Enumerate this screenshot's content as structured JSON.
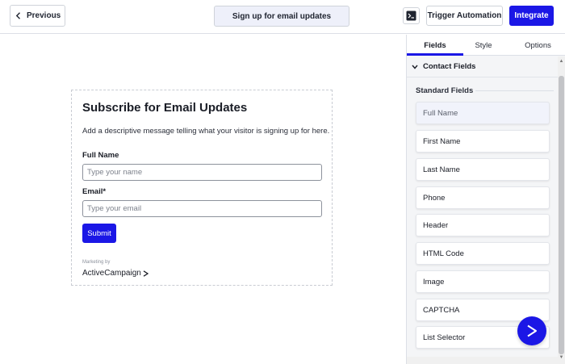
{
  "toolbar": {
    "previous_label": "Previous",
    "page_title": "Sign up for email updates",
    "trigger_label": "Trigger Automation",
    "integrate_label": "Integrate",
    "accent_color": "#1b17e6"
  },
  "form": {
    "title": "Subscribe for Email Updates",
    "description": "Add a descriptive message telling what your visitor is signing up for here.",
    "fields": [
      {
        "label": "Full Name",
        "placeholder": "Type your name"
      },
      {
        "label": "Email*",
        "placeholder": "Type your email"
      }
    ],
    "submit_label": "Submit",
    "marketing_by": "Marketing by",
    "brand": "ActiveCampaign"
  },
  "panel": {
    "tabs": [
      {
        "label": "Fields",
        "active": true
      },
      {
        "label": "Style",
        "active": false
      },
      {
        "label": "Options",
        "active": false
      }
    ],
    "section_title": "Contact Fields",
    "standard_label": "Standard Fields",
    "items": [
      {
        "label": "Full Name",
        "selected": true
      },
      {
        "label": "First Name",
        "selected": false
      },
      {
        "label": "Last Name",
        "selected": false
      },
      {
        "label": "Phone",
        "selected": false
      },
      {
        "label": "Header",
        "selected": false
      },
      {
        "label": "HTML Code",
        "selected": false
      },
      {
        "label": "Image",
        "selected": false
      },
      {
        "label": "CAPTCHA",
        "selected": false
      },
      {
        "label": "List Selector",
        "selected": false
      }
    ]
  }
}
